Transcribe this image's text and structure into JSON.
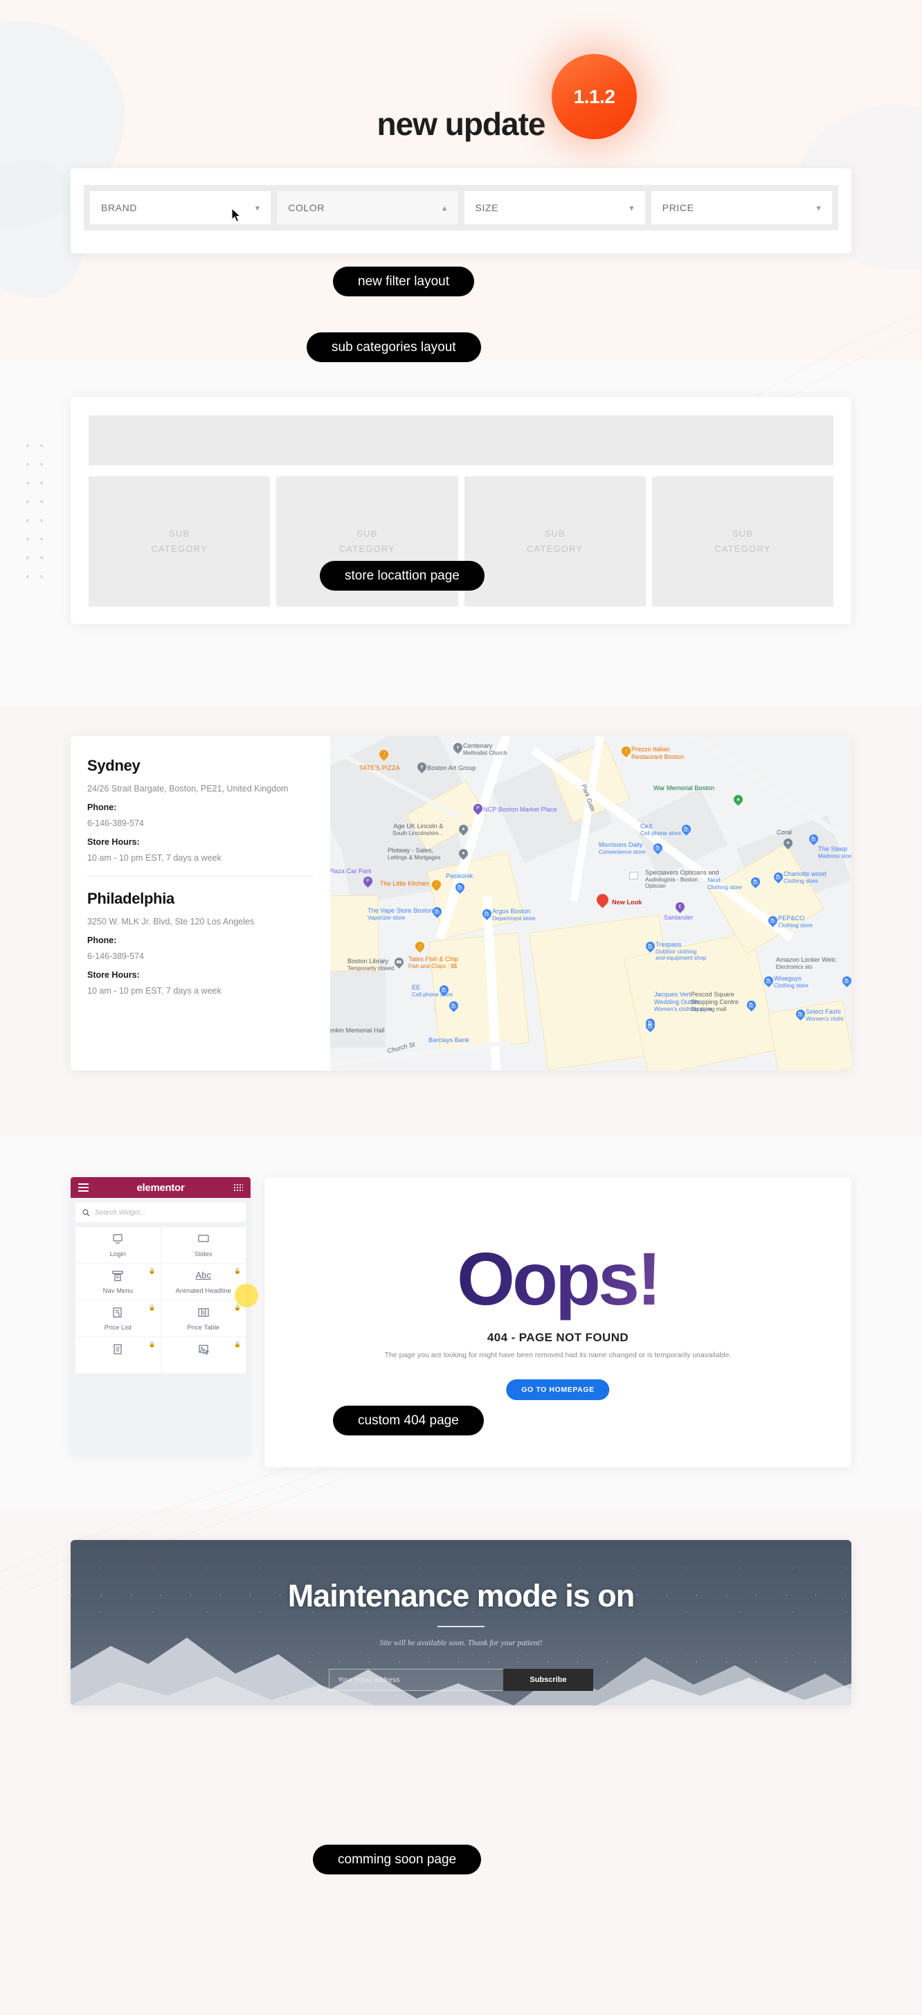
{
  "header": {
    "title": "new update",
    "version_badge": "1.1.2"
  },
  "colors": {
    "badge_orange": "#fb4f16",
    "pill_black": "#000000",
    "elementor_magenta": "#9b1f4d",
    "homepage_button_blue": "#1a73e8",
    "page_background": "#fdf8f5"
  },
  "filter_section": {
    "pill_label": "new filter layout",
    "filters": [
      {
        "label": "BRAND",
        "chevron": "chevron-down-icon",
        "state": "closed"
      },
      {
        "label": "COLOR",
        "chevron": "chevron-up-icon",
        "state": "open"
      },
      {
        "label": "SIZE",
        "chevron": "chevron-down-icon",
        "state": "closed"
      },
      {
        "label": "PRICE",
        "chevron": "chevron-down-icon",
        "state": "closed"
      }
    ]
  },
  "subcategory_section": {
    "pill_label": "sub categories layout",
    "tiles": [
      {
        "line1": "SUB",
        "line2": "CATEGORY"
      },
      {
        "line1": "SUB",
        "line2": "CATEGORY"
      },
      {
        "line1": "SUB",
        "line2": "CATEGORY"
      },
      {
        "line1": "SUB",
        "line2": "CATEGORY"
      }
    ]
  },
  "store_section": {
    "pill_label": "store locattion page",
    "stores": [
      {
        "name": "Sydney",
        "address": "24/26 Strait Bargate, Boston, PE21, United Kingdom",
        "phone_label": "Phone:",
        "phone": "6-146-389-574",
        "hours_label": "Store Hours:",
        "hours": "10 am - 10 pm EST, 7 days a week"
      },
      {
        "name": "Philadelphia",
        "address": "3250 W. MLK Jr. Blvd, Ste 120 Los Angeles",
        "phone_label": "Phone:",
        "phone": "6-146-389-574",
        "hours_label": "Store Hours:",
        "hours": "10 am - 10 pm EST, 7 days a week"
      }
    ],
    "map": {
      "street_labels": [
        "Park Gate",
        "Church St"
      ],
      "places": [
        {
          "name": "TATE'S PIZZA",
          "sub": "",
          "pin": "orange",
          "glyph": "restaurant-icon"
        },
        {
          "name": "Centenary",
          "sub": "Methodist Church",
          "pin": "gray",
          "glyph": "church-icon"
        },
        {
          "name": "Boston Art Group",
          "sub": "",
          "pin": "gray",
          "glyph": "church-icon"
        },
        {
          "name": "NCP Boston Market Place",
          "sub": "",
          "pin": "purple",
          "glyph": "parking-icon"
        },
        {
          "name": "Prezzo Italian",
          "sub": "Restaurant Boston",
          "pin": "orange",
          "glyph": "restaurant-icon"
        },
        {
          "name": "War Memorial Boston",
          "sub": "",
          "pin": "green",
          "glyph": "park-icon"
        },
        {
          "name": "Age UK Lincoln &",
          "sub": "South Lincolnshire...",
          "pin": "gray",
          "glyph": "place-icon"
        },
        {
          "name": "Plotway - Sales,",
          "sub": "Lettings & Mortgages",
          "pin": "gray",
          "glyph": "place-icon"
        },
        {
          "name": "CeX",
          "sub": "Cell phone store",
          "pin": "blue",
          "glyph": "store-icon"
        },
        {
          "name": "Morrisons Daily",
          "sub": "Convenience store",
          "pin": "blue",
          "glyph": "store-icon"
        },
        {
          "name": "Coral",
          "sub": "",
          "pin": "gray",
          "glyph": "place-icon"
        },
        {
          "name": "The Sleep",
          "sub": "Mattress store",
          "pin": "blue",
          "glyph": "store-icon"
        },
        {
          "name": "Charlotte wood",
          "sub": "Clothing store",
          "pin": "blue",
          "glyph": "store-icon"
        },
        {
          "name": "Specsavers Opticians and",
          "sub": "Audiologists - Boston",
          "pin": "none",
          "glyph": "optician-icon"
        },
        {
          "name": "Optician",
          "sub": "",
          "pin": "none",
          "glyph": ""
        },
        {
          "name": "Next",
          "sub": "Clothing store",
          "pin": "blue",
          "glyph": "store-icon"
        },
        {
          "name": "New Look",
          "sub": "",
          "pin": "red",
          "glyph": "marker-icon"
        },
        {
          "name": "Santander",
          "sub": "",
          "pin": "purple",
          "glyph": "bank-icon"
        },
        {
          "name": "PEP&CO",
          "sub": "Clothing store",
          "pin": "blue",
          "glyph": "store-icon"
        },
        {
          "name": "Plaza Car Park",
          "sub": "",
          "pin": "purple",
          "glyph": "parking-icon"
        },
        {
          "name": "The Little Kitchen",
          "sub": "",
          "pin": "orange",
          "glyph": "restaurant-icon"
        },
        {
          "name": "Pasikonik",
          "sub": "",
          "pin": "blue",
          "glyph": "store-icon"
        },
        {
          "name": "The Vape Store Boston",
          "sub": "Vaporizer store",
          "pin": "blue",
          "glyph": "store-icon"
        },
        {
          "name": "Argos Boston",
          "sub": "Department store",
          "pin": "blue",
          "glyph": "store-icon"
        },
        {
          "name": "Boston Library",
          "sub": "Temporarily closed",
          "pin": "gray",
          "glyph": "library-icon"
        },
        {
          "name": "Tates Fish & Chip",
          "sub": "Fish and Chips · $$",
          "pin": "orange",
          "glyph": "restaurant-icon"
        },
        {
          "name": "EE",
          "sub": "Cell phone store",
          "pin": "blue",
          "glyph": "store-icon"
        },
        {
          "name": "Trespass",
          "sub": "Outdoor clothing and equipment shop",
          "pin": "blue",
          "glyph": "store-icon"
        },
        {
          "name": "Jacques Vert -",
          "sub": "Wedding Outfits",
          "pin": "blue",
          "glyph": "store-icon"
        },
        {
          "name": "Women's clothing store",
          "sub": "",
          "pin": "none",
          "glyph": ""
        },
        {
          "name": "Pescod Square",
          "sub": "Shopping Centre",
          "pin": "blue",
          "glyph": "store-icon"
        },
        {
          "name": "Shopping mall",
          "sub": "",
          "pin": "none",
          "glyph": ""
        },
        {
          "name": "Wiseguys",
          "sub": "Clothing store",
          "pin": "blue",
          "glyph": "store-icon"
        },
        {
          "name": "Amazon Locker Welc",
          "sub": "Electronics sto",
          "pin": "blue",
          "glyph": "store-icon"
        },
        {
          "name": "Select Fashi",
          "sub": "Women's clothi",
          "pin": "blue",
          "glyph": "store-icon"
        },
        {
          "name": "Barclays Bank",
          "sub": "",
          "pin": "none",
          "glyph": ""
        },
        {
          "name": "enkin Memorial Hall",
          "sub": "",
          "pin": "none",
          "glyph": ""
        }
      ]
    }
  },
  "error_section": {
    "pill_label": "custom 404 page",
    "elementor": {
      "logo": "elementor",
      "menu_icon": "hamburger-icon",
      "grid_icon": "grid-icon",
      "search_icon": "search-icon",
      "search_placeholder": "Search Widget...",
      "widgets": [
        {
          "label": "Login",
          "icon": "login-icon",
          "locked": false
        },
        {
          "label": "Slides",
          "icon": "slides-icon",
          "locked": false
        },
        {
          "label": "Nav Menu",
          "icon": "nav-menu-icon",
          "locked": true
        },
        {
          "label": "Animated Headline",
          "icon": "abc-icon",
          "locked": true
        },
        {
          "label": "Price List",
          "icon": "price-list-icon",
          "locked": true
        },
        {
          "label": "Price Table",
          "icon": "price-table-icon",
          "locked": true
        },
        {
          "label": "",
          "icon": "document-icon",
          "locked": true
        },
        {
          "label": "",
          "icon": "media-icon",
          "locked": true
        }
      ]
    },
    "page": {
      "headline": "Oops!",
      "code": "404 - PAGE NOT FOUND",
      "description": "The page you are looking for might have been removed had its name changed or is temporarily unavailable.",
      "button": "GO TO HOMEPAGE"
    }
  },
  "maintenance_section": {
    "pill_label": "comming soon page",
    "title": "Maintenance mode is on",
    "subtitle": "Site will be available soon. Thank for your patient!",
    "email_placeholder": "Your email address",
    "subscribe_button": "Subscribe"
  }
}
